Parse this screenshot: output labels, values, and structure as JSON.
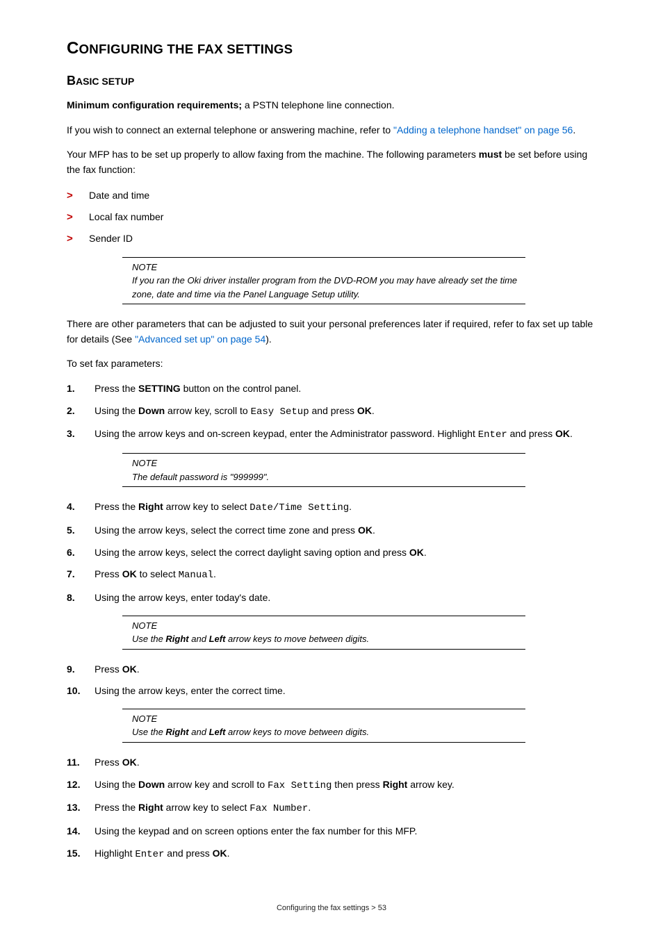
{
  "headings": {
    "h1_cap": "C",
    "h1_rest": "ONFIGURING THE FAX SETTINGS",
    "h2_cap": "B",
    "h2_rest": "ASIC SETUP"
  },
  "paras": {
    "p1_bold": "Minimum configuration requirements;",
    "p1_rest": " a PSTN telephone line connection.",
    "p2_a": "If you wish to connect an external telephone or answering machine, refer to ",
    "p2_link": "\"Adding a telephone handset\" on page 56",
    "p2_b": ".",
    "p3": "Your MFP has to be set up properly to allow faxing from the machine. The following parameters ",
    "p3_bold": "must",
    "p3_b": " be set before using the fax function:",
    "p4_a": "There are other parameters that can be adjusted to suit your personal preferences later if required, refer to fax set up table for details (See ",
    "p4_link": "\"Advanced set up\" on page 54",
    "p4_b": ").",
    "p5": "To set fax parameters:"
  },
  "bullets": [
    "Date and time",
    "Local fax number",
    "Sender ID"
  ],
  "notes": {
    "heading": "NOTE",
    "n1": "If you ran the Oki driver installer program from the DVD-ROM you may have already set the time zone, date and time via the Panel Language Setup utility.",
    "n2": "The default password is \"999999\".",
    "n3_a": "Use the ",
    "n3_right": "Right",
    "n3_mid": " and ",
    "n3_left": "Left",
    "n3_b": " arrow keys to move between digits."
  },
  "steps": {
    "s1_a": "Press the ",
    "s1_bold": "SETTING",
    "s1_b": " button on the control panel.",
    "s2_a": "Using the ",
    "s2_bold1": "Down",
    "s2_b": " arrow key, scroll to ",
    "s2_mono": "Easy Setup",
    "s2_c": " and press ",
    "s2_bold2": "OK",
    "s2_d": ".",
    "s3_a": "Using the arrow keys and on-screen keypad, enter the Administrator password. Highlight ",
    "s3_mono": "Enter",
    "s3_b": " and press ",
    "s3_bold": "OK",
    "s3_c": ".",
    "s4_a": "Press the ",
    "s4_bold": "Right",
    "s4_b": " arrow key to select ",
    "s4_mono": "Date/Time Setting",
    "s4_c": ".",
    "s5_a": "Using the arrow keys, select the correct time zone and press ",
    "s5_bold": "OK",
    "s5_b": ".",
    "s6_a": "Using the arrow keys, select the correct daylight saving option and press ",
    "s6_bold": "OK",
    "s6_b": ".",
    "s7_a": "Press ",
    "s7_bold": "OK",
    "s7_b": " to select ",
    "s7_mono": "Manual",
    "s7_c": ".",
    "s8": "Using the arrow keys, enter today's date.",
    "s9_a": "Press ",
    "s9_bold": "OK",
    "s9_b": ".",
    "s10": "Using the arrow keys, enter the correct time.",
    "s11_a": "Press ",
    "s11_bold": "OK",
    "s11_b": ".",
    "s12_a": "Using the ",
    "s12_bold1": "Down",
    "s12_b": " arrow key and scroll to ",
    "s12_mono": "Fax Setting",
    "s12_c": " then press ",
    "s12_bold2": "Right",
    "s12_d": " arrow key.",
    "s13_a": "Press the ",
    "s13_bold": "Right",
    "s13_b": " arrow key to select ",
    "s13_mono": "Fax Number",
    "s13_c": ".",
    "s14": "Using the keypad and on screen options enter the fax number for this MFP.",
    "s15_a": "Highlight ",
    "s15_mono": "Enter",
    "s15_b": " and press ",
    "s15_bold": "OK",
    "s15_c": "."
  },
  "numbers": {
    "n1": "1.",
    "n2": "2.",
    "n3": "3.",
    "n4": "4.",
    "n5": "5.",
    "n6": "6.",
    "n7": "7.",
    "n8": "8.",
    "n9": "9.",
    "n10": "10.",
    "n11": "11.",
    "n12": "12.",
    "n13": "13.",
    "n14": "14.",
    "n15": "15."
  },
  "footer": "Configuring the fax settings > 53"
}
